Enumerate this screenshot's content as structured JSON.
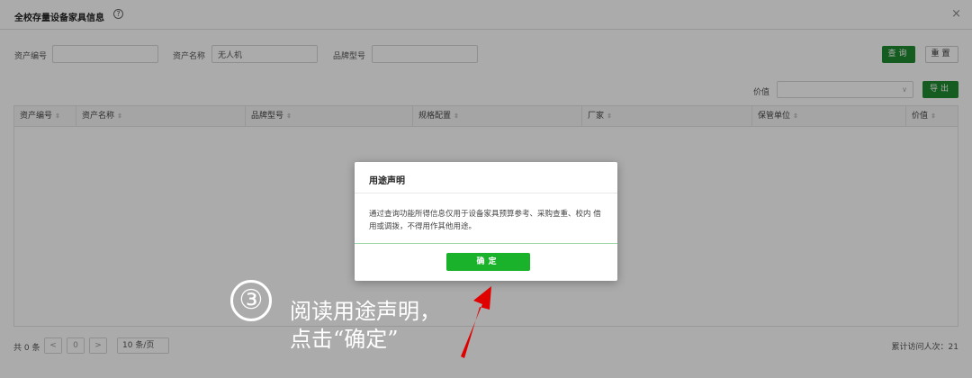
{
  "header": {
    "title": "全校存量设备家具信息",
    "help_icon": "?",
    "close_icon": "×"
  },
  "search_form": {
    "asset_no_label": "资产编号",
    "asset_no_value": "",
    "asset_name_label": "资产名称",
    "asset_name_value": "无人机",
    "model_label": "品牌型号",
    "model_value": "",
    "query_button": "查询",
    "reset_button": "重置"
  },
  "toolbar": {
    "price_label": "价值",
    "price_value": "",
    "export_button": "导出"
  },
  "table": {
    "columns": [
      "资产编号",
      "资产名称",
      "品牌型号",
      "规格配置",
      "厂家",
      "保管单位",
      "价值"
    ],
    "rows": []
  },
  "footer": {
    "total": "共 0 条",
    "prev": "<",
    "page": "0",
    "next": ">",
    "page_size": "10 条/页",
    "visits": "累计访问人次：21"
  },
  "modal": {
    "title": "用途声明",
    "body": "通过查询功能所得信息仅用于设备家具预算参考、采购查重、校内 借用或调拨，不得用作其他用途。",
    "ok_button": "确定"
  },
  "annotation": {
    "step": "③",
    "line1": "阅读用途声明，",
    "line2": "点击“确定”"
  },
  "colors": {
    "primary_green": "#1e8a2f",
    "modal_button_green": "#19b22a",
    "arrow_red": "#e00000"
  }
}
